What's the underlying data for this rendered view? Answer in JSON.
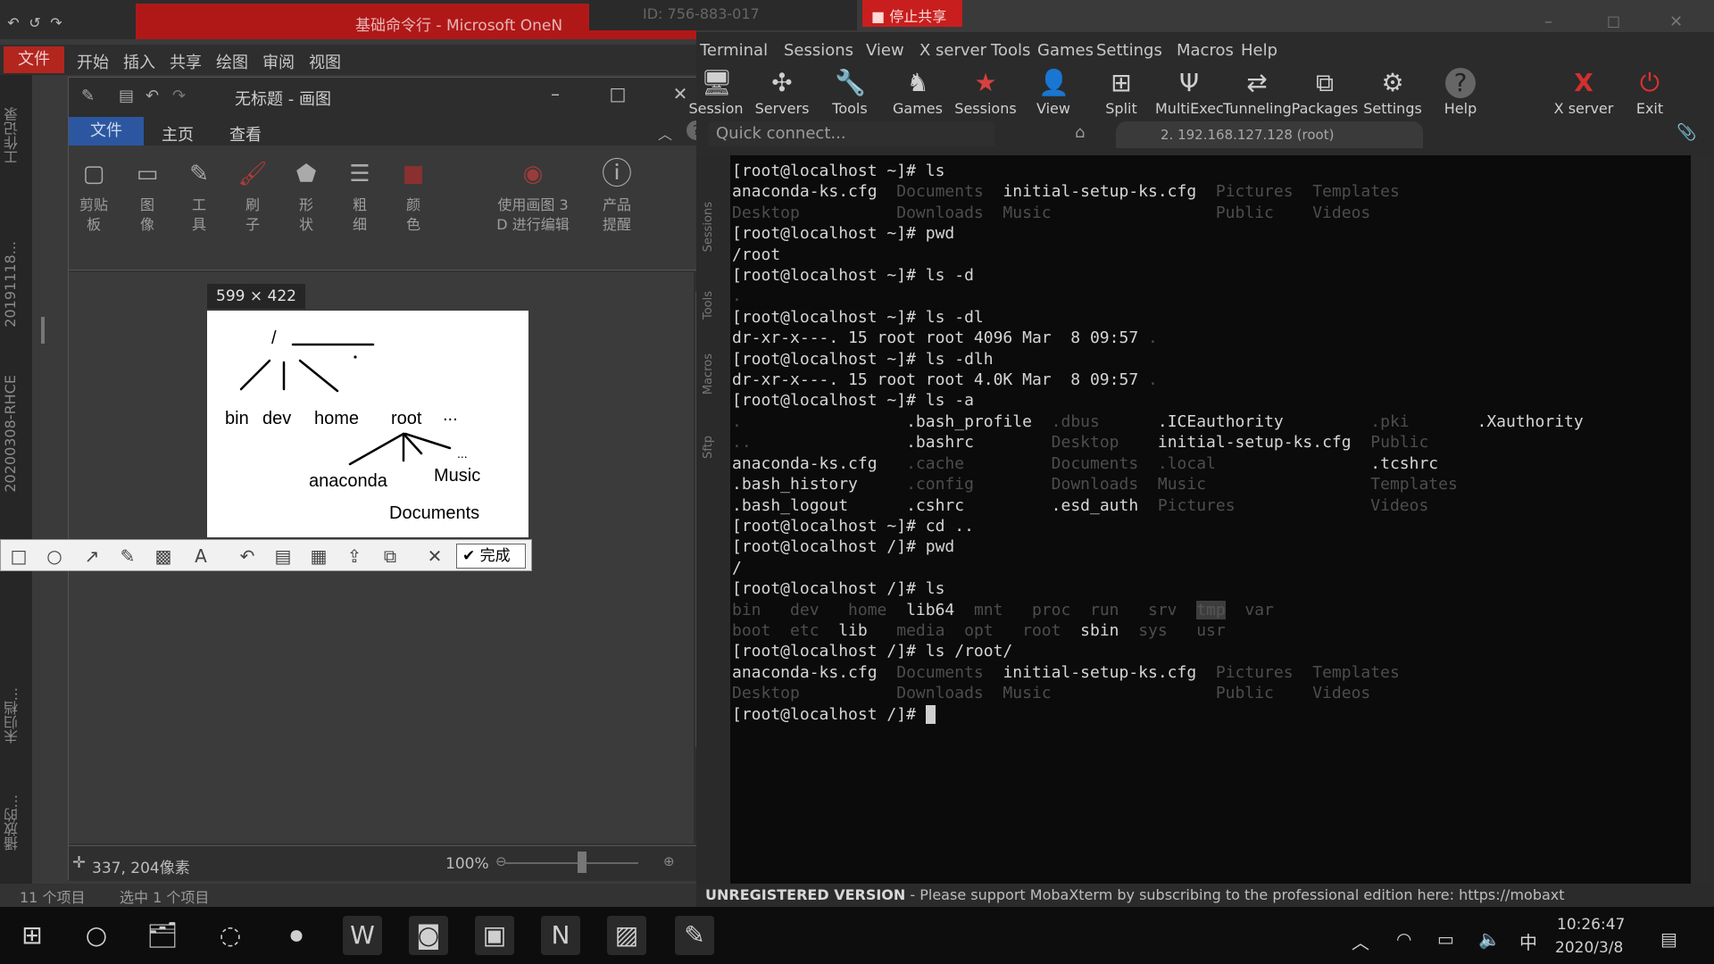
{
  "onenote": {
    "title": "基础命令行 - Microsoft OneN",
    "file_tab": "文件",
    "menu": [
      "开始",
      "插入",
      "共享",
      "绘图",
      "审阅",
      "视图"
    ],
    "rail_labels": [
      "工作记录",
      "20191118...",
      "20200308-RHCE",
      "未归档...",
      "播放的..."
    ]
  },
  "remote": {
    "id_label": "ID: 756-883-017",
    "stop_share": "停止共享"
  },
  "paint": {
    "title": "无标题 - 画图",
    "tabs": {
      "file": "文件",
      "home": "主页",
      "view": "查看"
    },
    "ribbon": [
      {
        "label": "剪贴板",
        "icon": "clipboard-icon",
        "glyph": "▢"
      },
      {
        "label": "图像",
        "icon": "image-icon",
        "glyph": "▭"
      },
      {
        "label": "工具",
        "icon": "pencil-icon",
        "glyph": "✎"
      },
      {
        "label": "刷子",
        "icon": "brush-icon",
        "glyph": "🖌"
      },
      {
        "label": "形状",
        "icon": "shapes-icon",
        "glyph": "⬟"
      },
      {
        "label": "粗细",
        "icon": "line-weight-icon",
        "glyph": "☰"
      },
      {
        "label": "颜色",
        "icon": "color-icon",
        "glyph": "■"
      },
      {
        "label": "使用画图 3 D 进行编辑",
        "icon": "paint3d-icon",
        "glyph": "◉"
      },
      {
        "label": "产品提醒",
        "icon": "info-icon",
        "glyph": "ⓘ"
      }
    ],
    "dimensions": "599 × 422",
    "status_coords": "337, 204像素",
    "zoom": "100%",
    "drawing_labels": {
      "root_slash": "/",
      "bin": "bin",
      "dev": "dev",
      "home": "home",
      "root": "root",
      "ellipsis": "...",
      "anaconda": "anaconda",
      "music": "Music",
      "documents": "Documents",
      "ellipsis2": "..."
    },
    "snip_done": "完成"
  },
  "explorer_status": {
    "items": "11 个项目",
    "selected": "选中 1 个项目"
  },
  "moba": {
    "menu": [
      "Terminal",
      "Sessions",
      "View",
      "X server",
      "Tools",
      "Games",
      "Settings",
      "Macros",
      "Help"
    ],
    "toolbar": [
      {
        "label": "Session",
        "icon": "session-icon",
        "glyph": "🖥"
      },
      {
        "label": "Servers",
        "icon": "servers-icon",
        "glyph": "✣"
      },
      {
        "label": "Tools",
        "icon": "tools-icon",
        "glyph": "🔧"
      },
      {
        "label": "Games",
        "icon": "games-icon",
        "glyph": "♞"
      },
      {
        "label": "Sessions",
        "icon": "star-icon",
        "glyph": "★"
      },
      {
        "label": "View",
        "icon": "view-icon",
        "glyph": "👤"
      },
      {
        "label": "Split",
        "icon": "split-icon",
        "glyph": "⊞"
      },
      {
        "label": "MultiExec",
        "icon": "multiexec-icon",
        "glyph": "Ψ"
      },
      {
        "label": "Tunneling",
        "icon": "tunneling-icon",
        "glyph": "⇄"
      },
      {
        "label": "Packages",
        "icon": "packages-icon",
        "glyph": "⧉"
      },
      {
        "label": "Settings",
        "icon": "settings-icon",
        "glyph": "⚙"
      },
      {
        "label": "Help",
        "icon": "help-icon",
        "glyph": "?"
      },
      {
        "label": "X server",
        "icon": "xserver-icon",
        "glyph": "X"
      },
      {
        "label": "Exit",
        "icon": "power-icon",
        "glyph": "⏻"
      }
    ],
    "quick_connect": "Quick connect...",
    "session_tab": "2. 192.168.127.128 (root)",
    "side_tabs": [
      "Sessions",
      "Tools",
      "Macros",
      "Sftp"
    ],
    "status_unreg": "UNREGISTERED VERSION",
    "status_msg": " -  Please support MobaXterm by subscribing to the professional edition here:  https://mobaxt",
    "terminal_lines": [
      [
        [
          "[root@localhost ~]# ls",
          ""
        ]
      ],
      [
        [
          "anaconda-ks.cfg  ",
          ""
        ],
        [
          "Documents  ",
          "dim"
        ],
        [
          "initial-setup-ks.cfg  ",
          ""
        ],
        [
          "Pictures  ",
          "dim"
        ],
        [
          "Templates",
          "dim"
        ]
      ],
      [
        [
          "Desktop          Downloads  Music                 Public    Videos",
          "dim"
        ]
      ],
      [
        [
          "[root@localhost ~]# pwd",
          ""
        ]
      ],
      [
        [
          "/root",
          ""
        ]
      ],
      [
        [
          "[root@localhost ~]# ls -d",
          ""
        ]
      ],
      [
        [
          ".",
          "dim"
        ]
      ],
      [
        [
          "[root@localhost ~]# ls -dl",
          ""
        ]
      ],
      [
        [
          "dr-xr-x---. 15 root root 4096 Mar  8 09:57 ",
          ""
        ],
        [
          ".",
          "dim"
        ]
      ],
      [
        [
          "[root@localhost ~]# ls -dlh",
          ""
        ]
      ],
      [
        [
          "dr-xr-x---. 15 root root 4.0K Mar  8 09:57 ",
          ""
        ],
        [
          ".",
          "dim"
        ]
      ],
      [
        [
          "[root@localhost ~]# ls -a",
          ""
        ]
      ],
      [
        [
          ".                 ",
          "dim"
        ],
        [
          ".bash_profile  ",
          ""
        ],
        [
          ".dbus      ",
          "dim"
        ],
        [
          ".ICEauthority         ",
          ""
        ],
        [
          ".pki       ",
          "dim"
        ],
        [
          ".Xauthority",
          ""
        ]
      ],
      [
        [
          "..                ",
          "dim"
        ],
        [
          ".bashrc        ",
          ""
        ],
        [
          "Desktop    ",
          "dim"
        ],
        [
          "initial-setup-ks.cfg  ",
          ""
        ],
        [
          "Public",
          "dim"
        ]
      ],
      [
        [
          "anaconda-ks.cfg   ",
          ""
        ],
        [
          ".cache         ",
          "dim"
        ],
        [
          "Documents  ",
          "dim"
        ],
        [
          ".local                ",
          "dim"
        ],
        [
          ".tcshrc",
          ""
        ]
      ],
      [
        [
          ".bash_history     ",
          ""
        ],
        [
          ".config        ",
          "dim"
        ],
        [
          "Downloads  ",
          "dim"
        ],
        [
          "Music                 ",
          "dim"
        ],
        [
          "Templates",
          "dim"
        ]
      ],
      [
        [
          ".bash_logout      ",
          ""
        ],
        [
          ".cshrc         ",
          ""
        ],
        [
          ".esd_auth  ",
          ""
        ],
        [
          "Pictures              ",
          "dim"
        ],
        [
          "Videos",
          "dim"
        ]
      ],
      [
        [
          "[root@localhost ~]# cd ..",
          ""
        ]
      ],
      [
        [
          "[root@localhost /]# pwd",
          ""
        ]
      ],
      [
        [
          "/",
          ""
        ]
      ],
      [
        [
          "[root@localhost /]# ls",
          ""
        ]
      ],
      [
        [
          "bin   dev   home  ",
          "dim"
        ],
        [
          "lib64  ",
          ""
        ],
        [
          "mnt   proc  run   srv  ",
          "dim"
        ],
        [
          "tmp",
          "hl"
        ],
        [
          "  var",
          "dim"
        ]
      ],
      [
        [
          "boot  etc  ",
          "dim"
        ],
        [
          "lib   ",
          ""
        ],
        [
          "media  opt   root  ",
          "dim"
        ],
        [
          "sbin  ",
          ""
        ],
        [
          "sys   usr",
          "dim"
        ]
      ],
      [
        [
          "[root@localhost /]# ls /root/",
          ""
        ]
      ],
      [
        [
          "anaconda-ks.cfg  ",
          ""
        ],
        [
          "Documents  ",
          "dim"
        ],
        [
          "initial-setup-ks.cfg  ",
          ""
        ],
        [
          "Pictures  ",
          "dim"
        ],
        [
          "Templates",
          "dim"
        ]
      ],
      [
        [
          "Desktop          Downloads  Music                 Public    Videos",
          "dim"
        ]
      ],
      [
        [
          "[root@localhost /]# ",
          ""
        ],
        [
          " ",
          "cursor"
        ]
      ]
    ]
  },
  "taskbar": {
    "apps": [
      {
        "name": "start-button",
        "glyph": "⊞"
      },
      {
        "name": "search-button",
        "glyph": "○"
      },
      {
        "name": "file-explorer-icon",
        "glyph": "🗂"
      },
      {
        "name": "app-circle-icon",
        "glyph": "◌"
      },
      {
        "name": "app-recorder-icon",
        "glyph": "⏺"
      },
      {
        "name": "word-icon",
        "glyph": "W"
      },
      {
        "name": "app-red-icon",
        "glyph": "◙"
      },
      {
        "name": "camera-icon",
        "glyph": "▣"
      },
      {
        "name": "onenote-icon",
        "glyph": "N"
      },
      {
        "name": "paint-icon",
        "glyph": "▨"
      },
      {
        "name": "mobaxterm-icon",
        "glyph": "✎"
      }
    ],
    "ime": "中",
    "time": "10:26:47",
    "date": "2020/3/8"
  }
}
